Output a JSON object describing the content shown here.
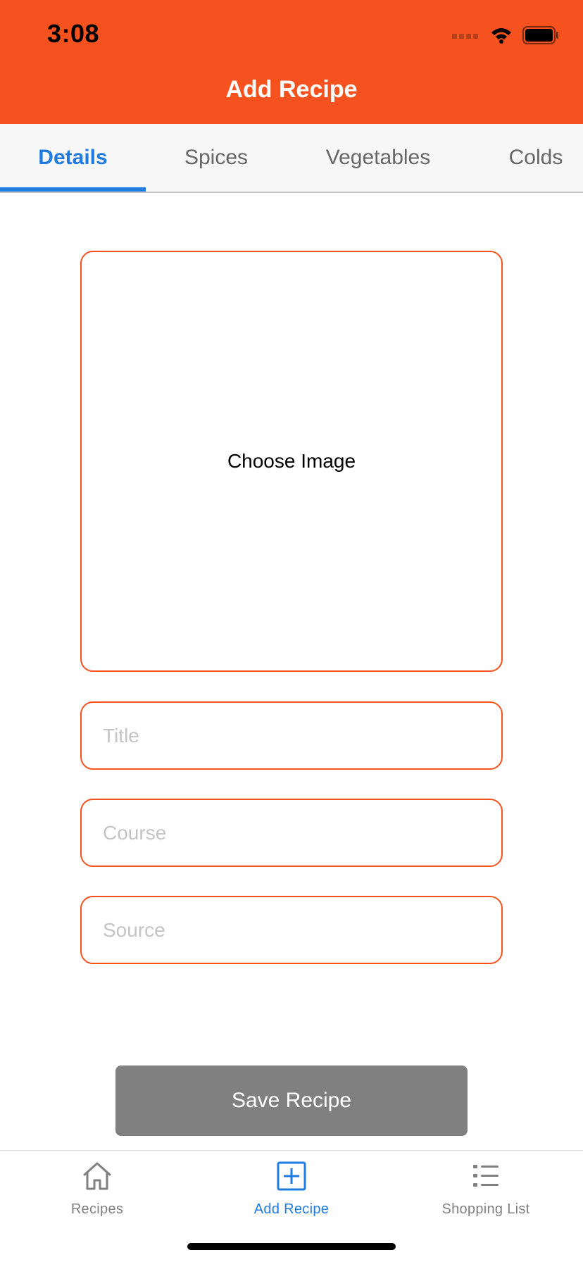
{
  "colors": {
    "brand": "#F5521F",
    "accent": "#1F7BE0",
    "save_button": "#808080",
    "inactive": "#808080"
  },
  "status_bar": {
    "time": "3:08",
    "icons": [
      "cellular-signal-icon",
      "wifi-icon",
      "battery-icon"
    ]
  },
  "header": {
    "title": "Add Recipe"
  },
  "tabs": [
    {
      "label": "Details",
      "active": true
    },
    {
      "label": "Spices",
      "active": false
    },
    {
      "label": "Vegetables",
      "active": false
    },
    {
      "label": "Colds",
      "active": false
    }
  ],
  "form": {
    "image_picker_label": "Choose Image",
    "title": {
      "value": "",
      "placeholder": "Title"
    },
    "course": {
      "value": "",
      "placeholder": "Course"
    },
    "source": {
      "value": "",
      "placeholder": "Source"
    },
    "save_label": "Save Recipe"
  },
  "bottom_nav": [
    {
      "label": "Recipes",
      "icon": "home-icon",
      "active": false
    },
    {
      "label": "Add Recipe",
      "icon": "add-square-icon",
      "active": true
    },
    {
      "label": "Shopping List",
      "icon": "list-icon",
      "active": false
    }
  ]
}
